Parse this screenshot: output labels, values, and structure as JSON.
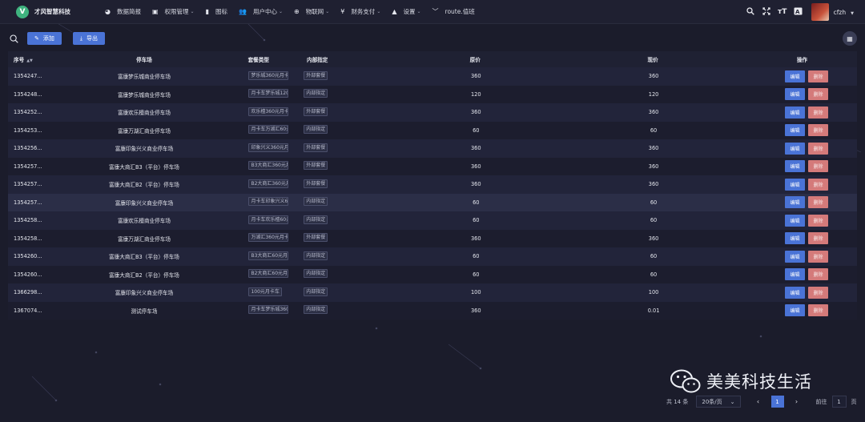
{
  "app": {
    "logo_letter": "V",
    "title": "才风智慧科技"
  },
  "nav": [
    {
      "icon": "dashboard-icon",
      "glyph": "◕",
      "label": "数据简报",
      "has_dropdown": false
    },
    {
      "icon": "lock-icon",
      "glyph": "▣",
      "label": "权限管理",
      "has_dropdown": true
    },
    {
      "icon": "image-icon",
      "glyph": "▮",
      "label": "图标",
      "has_dropdown": false
    },
    {
      "icon": "users-icon",
      "glyph": "👥",
      "label": "用户中心",
      "has_dropdown": true
    },
    {
      "icon": "iot-icon",
      "glyph": "⊕",
      "label": "物联网",
      "has_dropdown": true
    },
    {
      "icon": "yen-icon",
      "glyph": "¥",
      "label": "财务支付",
      "has_dropdown": true
    },
    {
      "icon": "settings-icon",
      "glyph": "▲",
      "label": "设置",
      "has_dropdown": true
    },
    {
      "icon": "route-icon",
      "glyph": "﹀",
      "label": "route.值班",
      "has_dropdown": false
    }
  ],
  "user": {
    "name": "cfzh"
  },
  "toolbar": {
    "add_label": "添加",
    "export_label": "导出"
  },
  "table": {
    "columns": {
      "id": "序号",
      "parking": "停车场",
      "package_type": "套餐类型",
      "internal": "内部指定",
      "original_price": "原价",
      "current_price": "现价",
      "actions": "操作"
    },
    "edit_label": "编辑",
    "delete_label": "删除",
    "rows": [
      {
        "id": "1354247...",
        "parking": "富康梦乐城商业停车场",
        "package": "梦乐城360元月卡",
        "internal": "外部套餐",
        "price": "360",
        "current": "360"
      },
      {
        "id": "1354248...",
        "parking": "富康梦乐城商业停车场",
        "package": "月卡车梦乐城120元",
        "internal": "内部指定",
        "price": "120",
        "current": "120"
      },
      {
        "id": "1354252...",
        "parking": "富康欢乐檀商业停车场",
        "package": "欢乐檀360元月卡",
        "internal": "外部套餐",
        "price": "360",
        "current": "360"
      },
      {
        "id": "1354253...",
        "parking": "富康万湖汇商业停车场",
        "package": "月卡车万湖汇60元",
        "internal": "内部指定",
        "price": "60",
        "current": "60"
      },
      {
        "id": "1354256...",
        "parking": "富康印象兴义商业停车场",
        "package": "印象兴义360元月卡",
        "internal": "外部套餐",
        "price": "360",
        "current": "360"
      },
      {
        "id": "1354257...",
        "parking": "富康大商汇B3（平台）停车场",
        "package": "B3大商汇360元月卡",
        "internal": "外部套餐",
        "price": "360",
        "current": "360"
      },
      {
        "id": "1354257...",
        "parking": "富康大商汇B2（平台）停车场",
        "package": "B2大商汇360元月卡",
        "internal": "外部套餐",
        "price": "360",
        "current": "360"
      },
      {
        "id": "1354257...",
        "parking": "富康印象兴义商业停车场",
        "package": "月卡车印象兴义60元",
        "internal": "内部指定",
        "price": "60",
        "current": "60"
      },
      {
        "id": "1354258...",
        "parking": "富康欢乐檀商业停车场",
        "package": "月卡车欢乐檀60元",
        "internal": "内部指定",
        "price": "60",
        "current": "60"
      },
      {
        "id": "1354258...",
        "parking": "富康万湖汇商业停车场",
        "package": "万湖汇360元月卡",
        "internal": "外部套餐",
        "price": "360",
        "current": "360"
      },
      {
        "id": "1354260...",
        "parking": "富康大商汇B3（平台）停车场",
        "package": "B3大商汇60元月卡",
        "internal": "内部指定",
        "price": "60",
        "current": "60"
      },
      {
        "id": "1354260...",
        "parking": "富康大商汇B2（平台）停车场",
        "package": "B2大商汇60元月卡",
        "internal": "内部指定",
        "price": "60",
        "current": "60"
      },
      {
        "id": "1366298...",
        "parking": "富康印象兴义商业停车场",
        "package": "100元月卡车",
        "internal": "内部指定",
        "price": "100",
        "current": "100"
      },
      {
        "id": "1367074...",
        "parking": "测试停车场",
        "package": "月卡车梦乐城360元",
        "internal": "内部指定",
        "price": "360",
        "current": "0.01"
      }
    ]
  },
  "pagination": {
    "total": "共 14 条",
    "page_size": "20条/页",
    "current_page": "1",
    "goto_label": "前往",
    "goto_value": "1",
    "page_suffix": "页"
  },
  "watermark": {
    "text": "美美科技生活"
  }
}
